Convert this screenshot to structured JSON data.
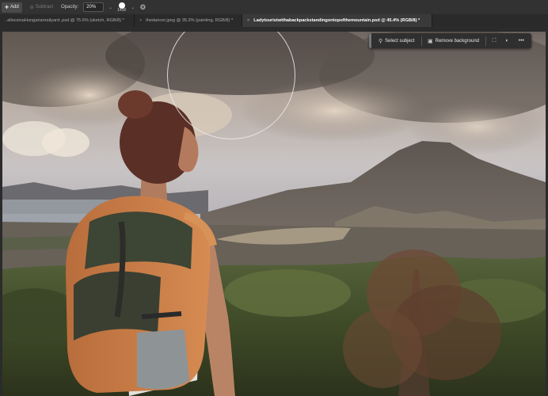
{
  "options_bar": {
    "add_label": "Add",
    "subtract_label": "Subtract",
    "opacity_label": "Opacity:",
    "opacity_value": "20%",
    "brush_size": "1400",
    "icons": [
      "plus-icon",
      "minus-icon",
      "chevron-down-icon",
      "gear-icon"
    ]
  },
  "tabs": [
    {
      "label": "..allocsinaHungarianrailyard..psd @ 75.6% (sketch, RGB/8) *",
      "active": false
    },
    {
      "label": "thedancer.jpeg @ 35.3% (painting, RGB/8) *",
      "active": false
    },
    {
      "label": "Ladytouristwithabackpackstandingontopofthemountain.psd @ 45.4% (RGB/8) *",
      "active": true
    }
  ],
  "task_bar": {
    "select_subject_label": "Select subject",
    "remove_background_label": "Remove background",
    "more_label": "•••"
  },
  "colors": {
    "panel": "#323232",
    "tab_bar": "#2a2a2a",
    "active_tab": "#3a3a3a"
  }
}
